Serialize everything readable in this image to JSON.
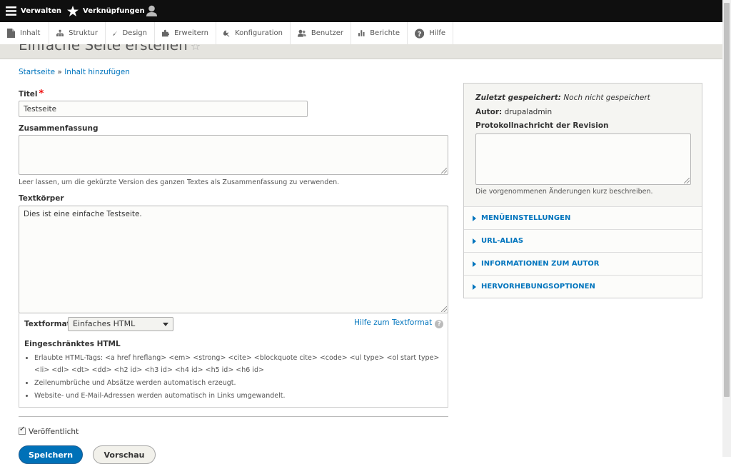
{
  "toolbar": {
    "manage": "Verwalten",
    "shortcuts": "Verknüpfungen"
  },
  "tray": [
    {
      "label": "Inhalt",
      "icon": "file-icon"
    },
    {
      "label": "Struktur",
      "icon": "sitemap-icon"
    },
    {
      "label": "Design",
      "icon": "brush-icon"
    },
    {
      "label": "Erweitern",
      "icon": "puzzle-icon"
    },
    {
      "label": "Konfiguration",
      "icon": "wrench-icon"
    },
    {
      "label": "Benutzer",
      "icon": "people-icon"
    },
    {
      "label": "Berichte",
      "icon": "bar-chart-icon"
    },
    {
      "label": "Hilfe",
      "icon": "help-icon"
    }
  ],
  "page": {
    "title": "Einfache Seite erstellen",
    "breadcrumb": [
      "Startseite",
      "Inhalt hinzufügen"
    ]
  },
  "form": {
    "title_label": "Titel",
    "title_value": "Testseite",
    "summary_label": "Zusammenfassung",
    "summary_value": "",
    "summary_desc": "Leer lassen, um die gekürzte Version des ganzen Textes als Zusammenfassung zu verwenden.",
    "body_label": "Textkörper",
    "body_value": "Dies ist eine einfache Testseite.",
    "format_label": "Textformat",
    "format_value": "Einfaches HTML",
    "format_help": "Hilfe zum Textformat",
    "format_heading": "Eingeschränktes HTML",
    "tips": [
      "Erlaubte HTML-Tags: <a href hreflang> <em> <strong> <cite> <blockquote cite> <code> <ul type> <ol start type> <li> <dl> <dt> <dd> <h2 id> <h3 id> <h4 id> <h5 id> <h6 id>",
      "Zeilenumbrüche und Absätze werden automatisch erzeugt.",
      "Website- und E-Mail-Adressen werden automatisch in Links umgewandelt."
    ],
    "published_label": "Veröffentlicht",
    "save_label": "Speichern",
    "preview_label": "Vorschau"
  },
  "sidebar": {
    "last_saved_label": "Zuletzt gespeichert:",
    "last_saved_value": "Noch nicht gespeichert",
    "author_label": "Autor:",
    "author_value": "drupaladmin",
    "revision_label": "Protokollnachricht der Revision",
    "revision_desc": "Die vorgenommenen Änderungen kurz beschreiben.",
    "sections": [
      "MENÜEINSTELLUNGEN",
      "URL-ALIAS",
      "INFORMATIONEN ZUM AUTOR",
      "HERVORHEBUNGSOPTIONEN"
    ]
  },
  "colors": {
    "link": "#0074bd",
    "primary_button": "#0071b8",
    "toolbar": "#0f0f0f"
  }
}
